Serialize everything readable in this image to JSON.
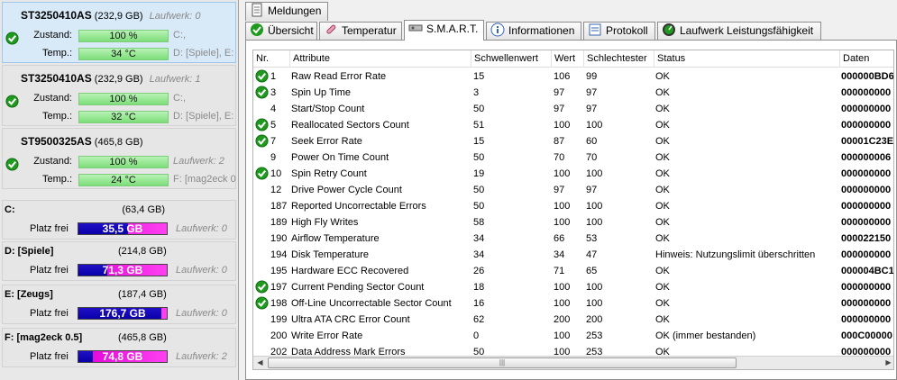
{
  "drives": [
    {
      "model": "ST3250410AS",
      "size": "(232,9 GB)",
      "laufwerk": "Laufwerk: 0",
      "zustand_label": "Zustand:",
      "zustand_value": "100 %",
      "temp_label": "Temp.:",
      "temp_value": "34 °C",
      "side1": "C:,",
      "side2": "D: [Spiele], E:"
    },
    {
      "model": "ST3250410AS",
      "size": "(232,9 GB)",
      "laufwerk": "Laufwerk: 1",
      "zustand_label": "Zustand:",
      "zustand_value": "100 %",
      "temp_label": "Temp.:",
      "temp_value": "32 °C",
      "side1": "C:,",
      "side2": "D: [Spiele], E:"
    },
    {
      "model": "ST9500325AS",
      "size": "(465,8 GB)",
      "laufwerk": "Laufwerk: 2",
      "zustand_label": "Zustand:",
      "zustand_value": "100 %",
      "temp_label": "Temp.:",
      "temp_value": "24 °C",
      "side1": "",
      "side2": "F: [mag2eck 0"
    }
  ],
  "partitions": [
    {
      "name": "C:",
      "size": "(63,4 GB)",
      "label": "Platz frei",
      "free": "35,5 GB",
      "free_fraction": 0.56,
      "laufwerk": "Laufwerk: 0"
    },
    {
      "name": "D: [Spiele]",
      "size": "(214,8 GB)",
      "label": "Platz frei",
      "free": "71,3 GB",
      "free_fraction": 0.33,
      "laufwerk": "Laufwerk: 0"
    },
    {
      "name": "E: [Zeugs]",
      "size": "(187,4 GB)",
      "label": "Platz frei",
      "free": "176,7 GB",
      "free_fraction": 0.94,
      "laufwerk": "Laufwerk: 0"
    },
    {
      "name": "F: [mag2eck 0.5]",
      "size": "(465,8 GB)",
      "label": "Platz frei",
      "free": "74,8 GB",
      "free_fraction": 0.16,
      "laufwerk": "Laufwerk: 2"
    }
  ],
  "tabs": {
    "meldungen": "Meldungen",
    "uebersicht": "Übersicht",
    "temperatur": "Temperatur",
    "smart": "S.M.A.R.T.",
    "informationen": "Informationen",
    "protokoll": "Protokoll",
    "leistung": "Laufwerk Leistungsfähigkeit"
  },
  "table": {
    "headers": {
      "nr": "Nr.",
      "attribute": "Attribute",
      "schwellenwert": "Schwellenwert",
      "wert": "Wert",
      "schlechtester": "Schlechtester",
      "status": "Status",
      "daten": "Daten"
    },
    "rows": [
      {
        "ok_icon": true,
        "nr": "1",
        "attr": "Raw Read Error Rate",
        "sw": "15",
        "wert": "106",
        "sch": "99",
        "status": "OK",
        "daten": "000000BD6"
      },
      {
        "ok_icon": true,
        "nr": "3",
        "attr": "Spin Up Time",
        "sw": "3",
        "wert": "97",
        "sch": "97",
        "status": "OK",
        "daten": "000000000"
      },
      {
        "ok_icon": false,
        "nr": "4",
        "attr": "Start/Stop Count",
        "sw": "50",
        "wert": "97",
        "sch": "97",
        "status": "OK",
        "daten": "000000000"
      },
      {
        "ok_icon": true,
        "nr": "5",
        "attr": "Reallocated Sectors Count",
        "sw": "51",
        "wert": "100",
        "sch": "100",
        "status": "OK",
        "daten": "000000000"
      },
      {
        "ok_icon": true,
        "nr": "7",
        "attr": "Seek Error Rate",
        "sw": "15",
        "wert": "87",
        "sch": "60",
        "status": "OK",
        "daten": "00001C23E"
      },
      {
        "ok_icon": false,
        "nr": "9",
        "attr": "Power On Time Count",
        "sw": "50",
        "wert": "70",
        "sch": "70",
        "status": "OK",
        "daten": "000000006"
      },
      {
        "ok_icon": true,
        "nr": "10",
        "attr": "Spin Retry Count",
        "sw": "19",
        "wert": "100",
        "sch": "100",
        "status": "OK",
        "daten": "000000000"
      },
      {
        "ok_icon": false,
        "nr": "12",
        "attr": "Drive Power Cycle Count",
        "sw": "50",
        "wert": "97",
        "sch": "97",
        "status": "OK",
        "daten": "000000000"
      },
      {
        "ok_icon": false,
        "nr": "187",
        "attr": "Reported Uncorrectable Errors",
        "sw": "50",
        "wert": "100",
        "sch": "100",
        "status": "OK",
        "daten": "000000000"
      },
      {
        "ok_icon": false,
        "nr": "189",
        "attr": "High Fly Writes",
        "sw": "58",
        "wert": "100",
        "sch": "100",
        "status": "OK",
        "daten": "000000000"
      },
      {
        "ok_icon": false,
        "nr": "190",
        "attr": "Airflow Temperature",
        "sw": "34",
        "wert": "66",
        "sch": "53",
        "status": "OK",
        "daten": "000022150"
      },
      {
        "ok_icon": false,
        "nr": "194",
        "attr": "Disk Temperature",
        "sw": "34",
        "wert": "34",
        "sch": "47",
        "status": "Hinweis: Nutzungslimit überschritten",
        "daten": "000000000"
      },
      {
        "ok_icon": false,
        "nr": "195",
        "attr": "Hardware ECC Recovered",
        "sw": "26",
        "wert": "71",
        "sch": "65",
        "status": "OK",
        "daten": "000004BC1"
      },
      {
        "ok_icon": true,
        "nr": "197",
        "attr": "Current Pending Sector Count",
        "sw": "18",
        "wert": "100",
        "sch": "100",
        "status": "OK",
        "daten": "000000000"
      },
      {
        "ok_icon": true,
        "nr": "198",
        "attr": "Off-Line Uncorrectable Sector Count",
        "sw": "16",
        "wert": "100",
        "sch": "100",
        "status": "OK",
        "daten": "000000000"
      },
      {
        "ok_icon": false,
        "nr": "199",
        "attr": "Ultra ATA CRC Error Count",
        "sw": "62",
        "wert": "200",
        "sch": "200",
        "status": "OK",
        "daten": "000000000"
      },
      {
        "ok_icon": false,
        "nr": "200",
        "attr": "Write Error Rate",
        "sw": "0",
        "wert": "100",
        "sch": "253",
        "status": "OK (immer bestanden)",
        "daten": "000C00000"
      },
      {
        "ok_icon": false,
        "nr": "202",
        "attr": "Data Address Mark Errors",
        "sw": "50",
        "wert": "100",
        "sch": "253",
        "status": "OK",
        "daten": "000000000"
      }
    ]
  },
  "colors": {
    "ok_green": "#1f9a1f",
    "zustand_bar": "#8ee98b",
    "free_bar": "#1408b8",
    "used_bar": "#f020e8",
    "selection": "#d8e9f8"
  }
}
